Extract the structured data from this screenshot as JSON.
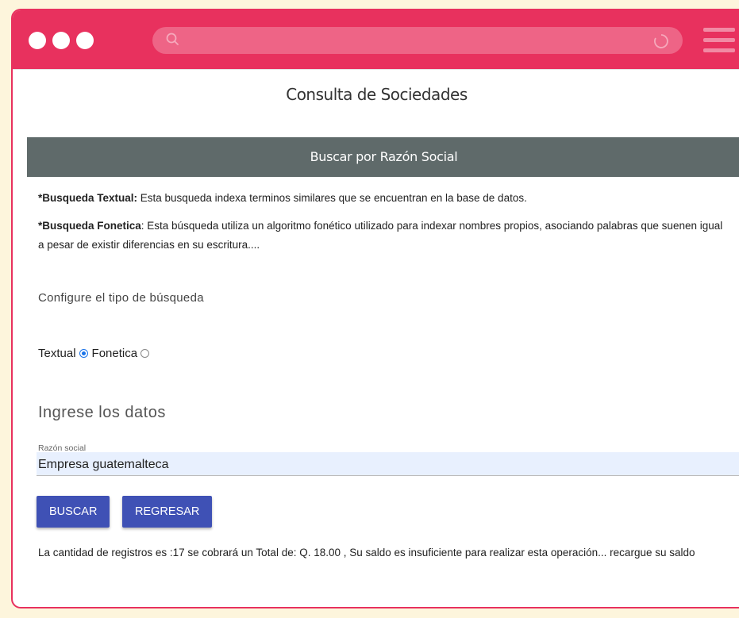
{
  "app": {
    "accent_color": "#e8315e",
    "page_title": "Consulta de Sociedades"
  },
  "section": {
    "title": "Buscar por Razón Social"
  },
  "info": {
    "textual_label": "*Busqueda Textual:",
    "textual_text": " Esta busqueda indexa terminos similares que se encuentran en la base de datos.",
    "fonetica_label": "*Busqueda Fonetica",
    "fonetica_text": ": Esta búsqueda utiliza un algoritmo fonético utilizado para indexar nombres propios, asociando palabras que suenen igual a pesar de existir diferencias en su escritura...."
  },
  "search_type": {
    "heading": "Configure el tipo de búsqueda",
    "options": [
      {
        "label": "Textual",
        "checked": true
      },
      {
        "label": "Fonetica",
        "checked": false
      }
    ]
  },
  "form": {
    "heading": "Ingrese los datos",
    "field_label": "Razón social",
    "field_value": "Empresa guatemalteca"
  },
  "buttons": {
    "search_label": "BUSCAR",
    "back_label": "REGRESAR",
    "color": "#3f51b5"
  },
  "result": {
    "message": "La cantidad de registros es :17 se cobrará un Total de: Q. 18.00 , Su saldo es insuficiente para realizar esta operación... recargue su saldo"
  }
}
